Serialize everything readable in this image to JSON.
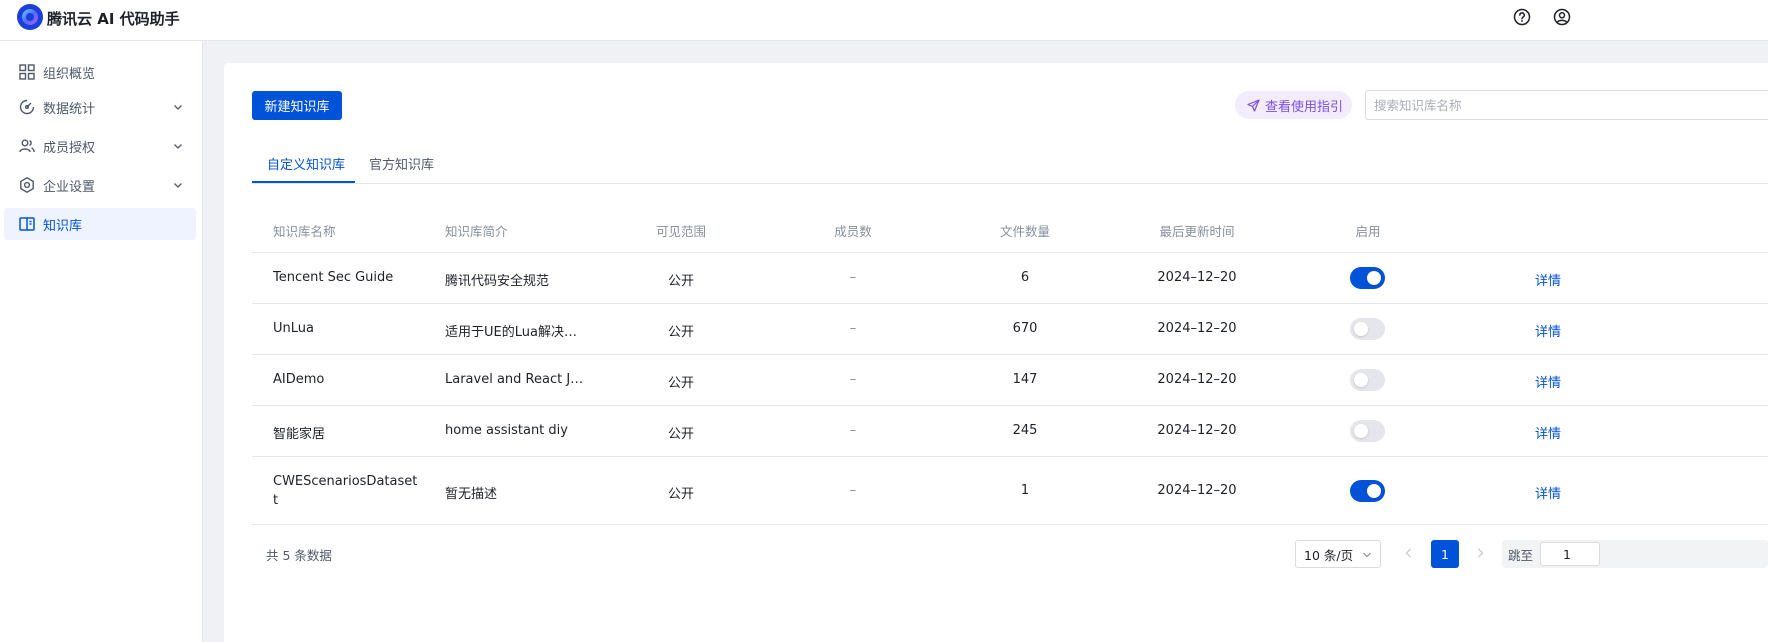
{
  "app": {
    "title": "腾讯云 AI 代码助手"
  },
  "sidebar": {
    "items": [
      {
        "label": "组织概览",
        "icon": "grid-icon"
      },
      {
        "label": "数据统计",
        "icon": "chart-icon"
      },
      {
        "label": "成员授权",
        "icon": "users-icon"
      },
      {
        "label": "企业设置",
        "icon": "hexagon-settings-icon"
      },
      {
        "label": "知识库",
        "icon": "book-icon"
      }
    ]
  },
  "toolbar": {
    "new_label": "新建知识库",
    "guide_label": "查看使用指引",
    "search_placeholder": "搜索知识库名称"
  },
  "tabs": [
    {
      "label": "自定义知识库"
    },
    {
      "label": "官方知识库"
    }
  ],
  "table": {
    "columns": [
      "知识库名称",
      "知识库简介",
      "可见范围",
      "成员数",
      "文件数量",
      "最后更新时间",
      "启用"
    ],
    "rows": [
      {
        "name": "Tencent Sec Guide",
        "name2": "",
        "desc": "腾讯代码安全规范",
        "scope": "公开",
        "members": "–",
        "files": "6",
        "updated": "2024–12–20",
        "enabled": true,
        "action": "详情"
      },
      {
        "name": "UnLua",
        "name2": "",
        "desc": "适用于UE的Lua解决…",
        "scope": "公开",
        "members": "–",
        "files": "670",
        "updated": "2024–12–20",
        "enabled": false,
        "action": "详情"
      },
      {
        "name": "AIDemo",
        "name2": "",
        "desc": "Laravel and React J…",
        "scope": "公开",
        "members": "–",
        "files": "147",
        "updated": "2024–12–20",
        "enabled": false,
        "action": "详情"
      },
      {
        "name": "智能家居",
        "name2": "",
        "desc": "home assistant diy",
        "scope": "公开",
        "members": "–",
        "files": "245",
        "updated": "2024–12–20",
        "enabled": false,
        "action": "详情"
      },
      {
        "name": "CWEScenariosDataset",
        "name2": "t",
        "desc": "暂无描述",
        "scope": "公开",
        "members": "–",
        "files": "1",
        "updated": "2024–12–20",
        "enabled": true,
        "action": "详情"
      }
    ]
  },
  "footer": {
    "total": "共 5 条数据",
    "page_size": "10 条/页",
    "current_page": "1",
    "jump_label": "跳至",
    "jump_value": "1"
  },
  "colors": {
    "primary": "#0052d9",
    "guide": "#7b4fe0",
    "bg": "#f0f1f5"
  }
}
